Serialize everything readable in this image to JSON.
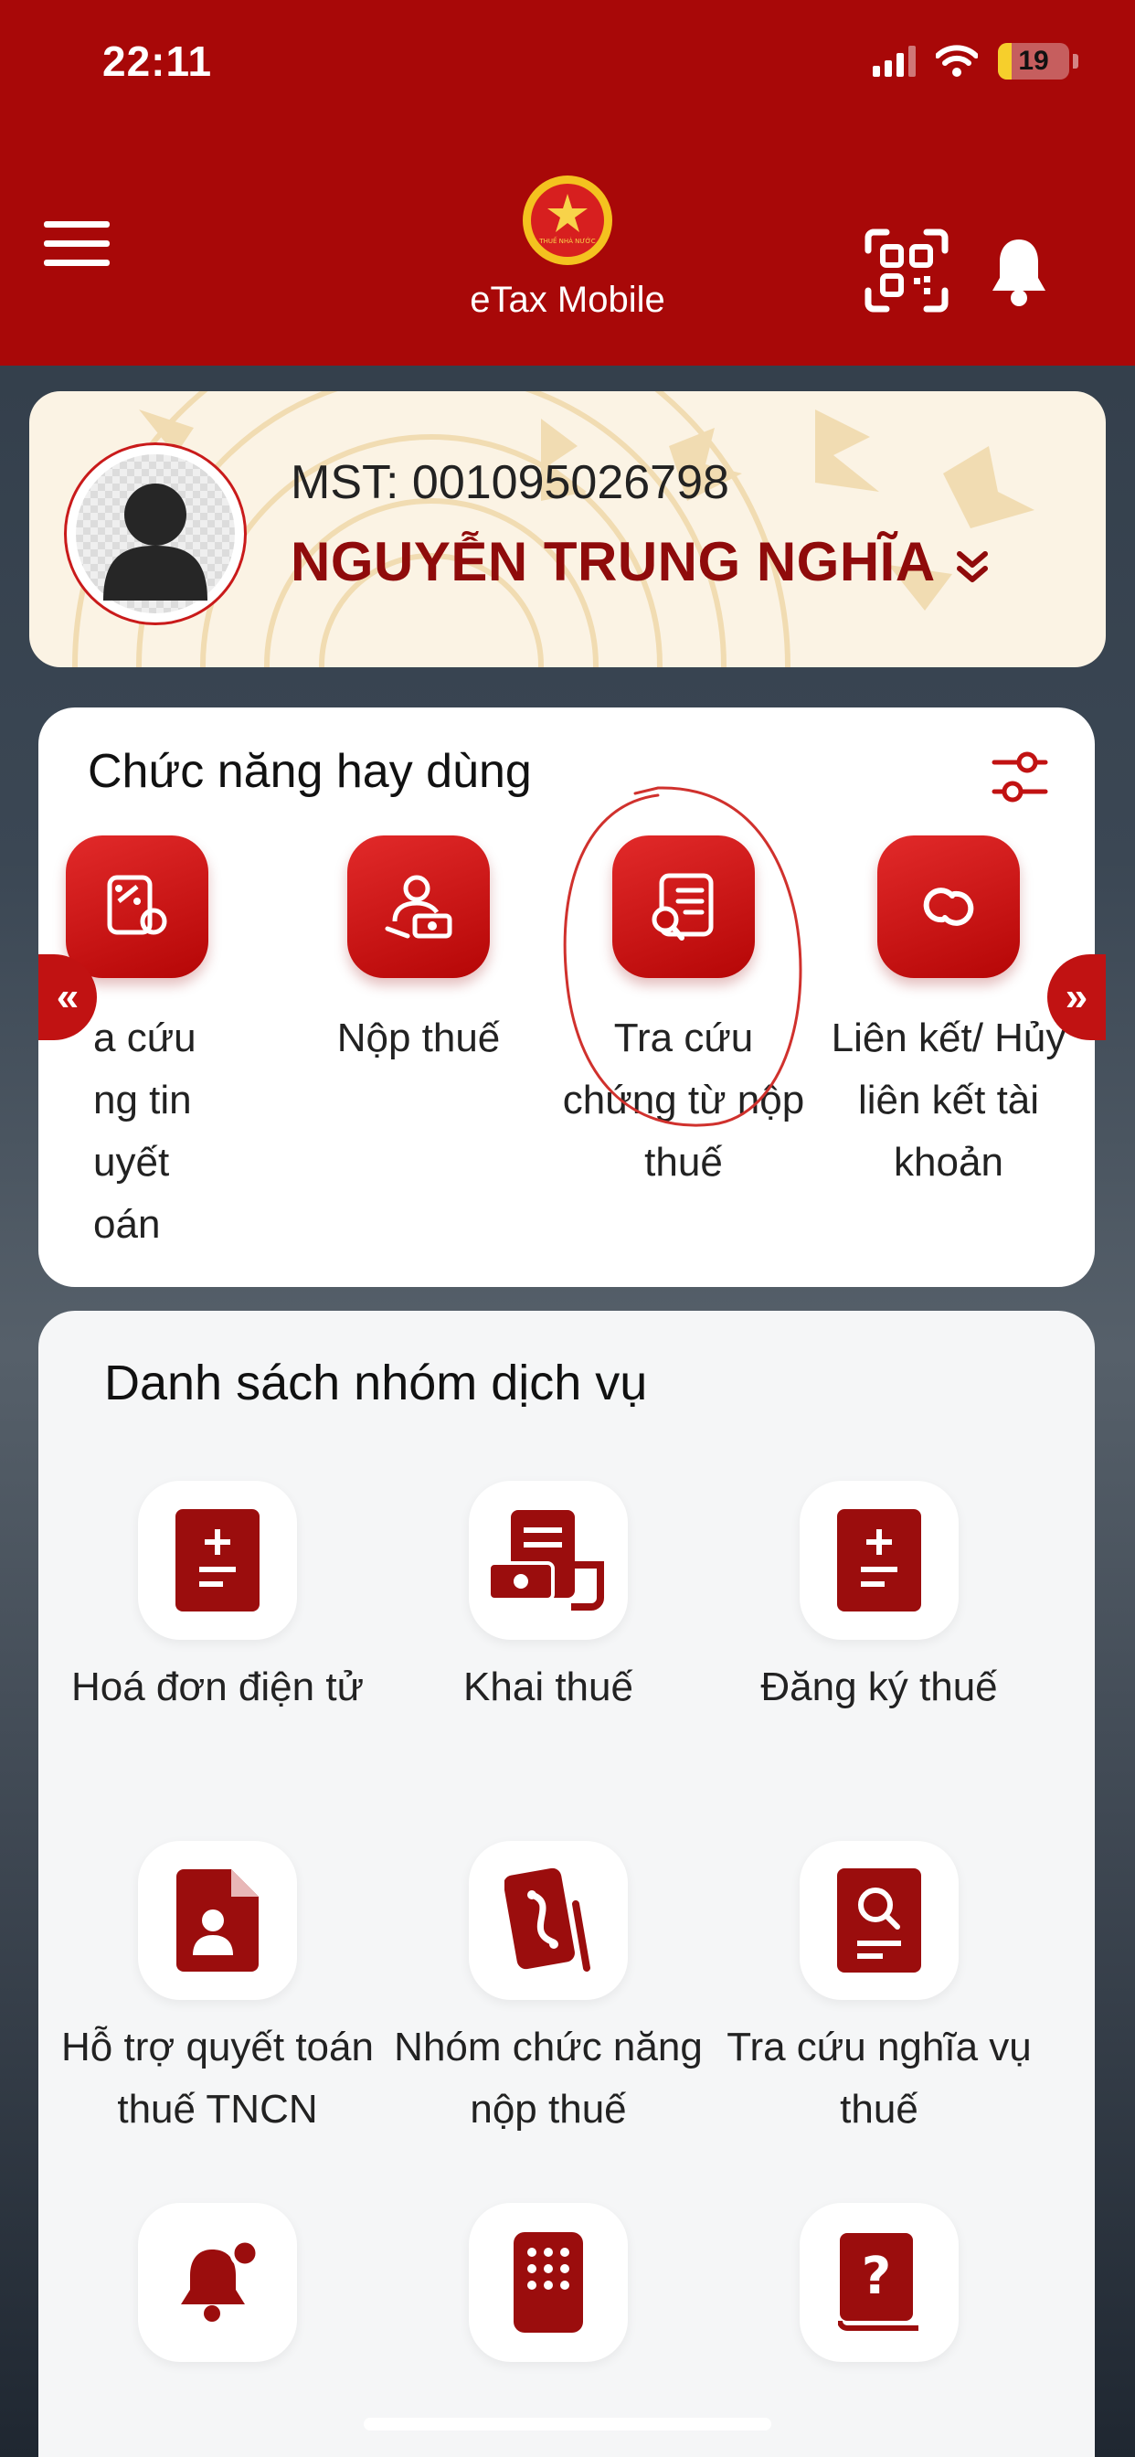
{
  "status_bar": {
    "time": "22:11",
    "battery": "19",
    "battery_fraction": 0.19
  },
  "header": {
    "app_title": "eTax Mobile",
    "logo_text": "THUẾ NHÀ NƯỚC"
  },
  "profile": {
    "mst": "MST: 001095026798",
    "name": "NGUYỄN TRUNG NGHĨA"
  },
  "favorites": {
    "title": "Chức năng hay dùng",
    "prev_label": "«",
    "next_label": "»",
    "items": [
      {
        "label": "Tra cứu thông tin quyết toán",
        "visible_text": "a cứu\nng tin\nuyết\noán",
        "icon": "percent-document-icon"
      },
      {
        "label": "Nộp thuế",
        "icon": "pay-tax-icon"
      },
      {
        "label": "Tra cứu chứng từ nộp thuế",
        "icon": "search-document-icon"
      },
      {
        "label": "Liên kết/ Hủy liên kết tài khoản",
        "icon": "link-icon"
      }
    ]
  },
  "services": {
    "title": "Danh sách nhóm dịch vụ",
    "items": [
      {
        "label": "Hoá đơn điện tử",
        "icon": "invoice-icon"
      },
      {
        "label": "Khai thuế",
        "icon": "tax-declaration-icon"
      },
      {
        "label": "Đăng ký thuế",
        "icon": "tax-registration-icon"
      },
      {
        "label": "Hỗ trợ quyết toán thuế TNCN",
        "icon": "personal-document-icon"
      },
      {
        "label": "Nhóm chức năng nộp thuế",
        "icon": "payment-group-icon"
      },
      {
        "label": "Tra cứu nghĩa vụ thuế",
        "icon": "search-obligation-icon"
      },
      {
        "label": "",
        "icon": "notification-icon"
      },
      {
        "label": "",
        "icon": "keypad-icon"
      },
      {
        "label": "",
        "icon": "help-book-icon"
      }
    ]
  },
  "colors": {
    "primary": "#a80808",
    "accent": "#c11212",
    "dark_red": "#8f0b0b",
    "annotation": "#d0312d"
  }
}
